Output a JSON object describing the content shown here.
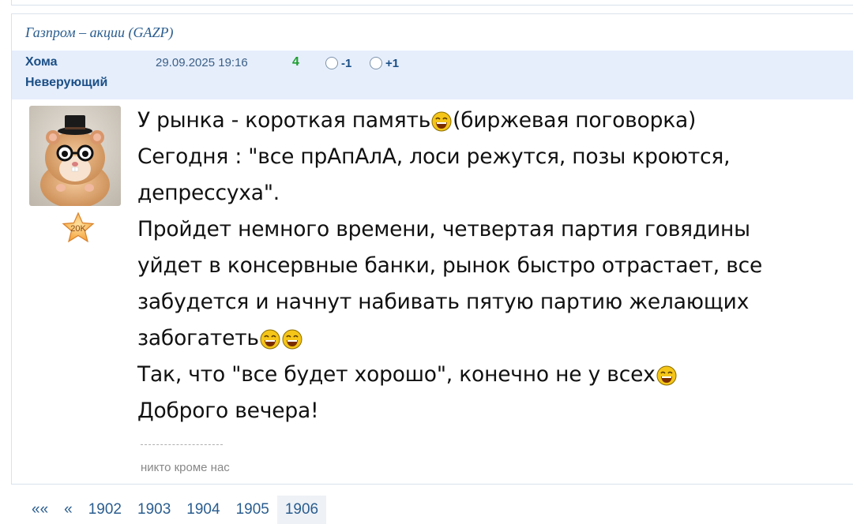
{
  "topic": {
    "title": "Газпром – акции (GAZP)"
  },
  "post": {
    "author": "Хома",
    "status": "Неверующий",
    "datetime": "29.09.2025 19:16",
    "rating": "4",
    "vote_minus": "-1",
    "vote_plus": "+1",
    "rank_badge": "20K",
    "lines": {
      "l1a": "У рынка - короткая память",
      "l1b": "(биржевая поговорка)",
      "l2": "Сегодня : \"все прАпАлА, лоси режутся, позы кроются,",
      "l3": "депрессуха\".",
      "l4": "Пройдет немного времени, четвертая партия говядины",
      "l5": "уйдет в консервные банки, рынок быстро отрастает, все",
      "l6": "забудется и начнут набивать пятую партию желающих",
      "l7": "забогатеть",
      "l8": "Так, что \"все будет хорошо\", конечно не у всех",
      "l9": "Доброго вечера!"
    },
    "signature_separator": "--------------------",
    "signature": "никто кроме нас"
  },
  "pagination": {
    "first": "««",
    "prev": "«",
    "pages": [
      "1902",
      "1903",
      "1904",
      "1905",
      "1906"
    ],
    "current": "1906"
  },
  "colors": {
    "header_bg": "#e6eefc",
    "link": "#2a5d8f",
    "author": "#1b4f86",
    "rating": "#1e9e2f",
    "emoji_face": "#f5c518"
  },
  "icons": {
    "emoji": "laughing-face-icon",
    "avatar": "hamster-with-top-hat-avatar",
    "badge": "star-badge-icon"
  }
}
